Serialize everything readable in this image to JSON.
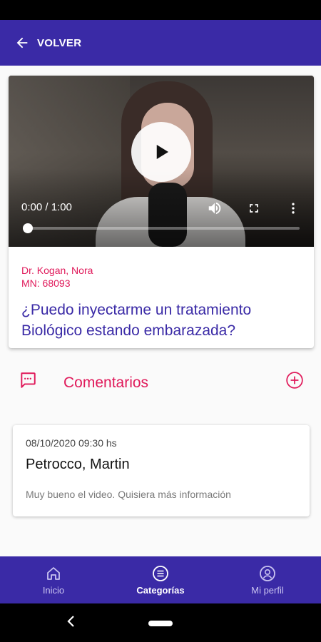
{
  "appbar": {
    "back_label": "VOLVER"
  },
  "video": {
    "time": "0:00 / 1:00",
    "progress": 0
  },
  "item": {
    "doctor": "Dr. Kogan, Nora",
    "license": "MN: 68093",
    "title": "¿Puedo inyectarme un tratamiento Biológico estando embarazada?"
  },
  "comments": {
    "heading": "Comentarios",
    "items": [
      {
        "date": "08/10/2020 09:30 hs",
        "author": "Petrocco, Martin",
        "text": "Muy bueno el video. Quisiera más información"
      }
    ]
  },
  "bottom_nav": {
    "items": [
      {
        "label": "Inicio",
        "icon": "home-icon"
      },
      {
        "label": "Categorías",
        "icon": "list-icon",
        "active": true
      },
      {
        "label": "Mi perfil",
        "icon": "account-icon"
      }
    ]
  },
  "colors": {
    "primary": "#3a2aa6",
    "accent": "#e0195a"
  }
}
